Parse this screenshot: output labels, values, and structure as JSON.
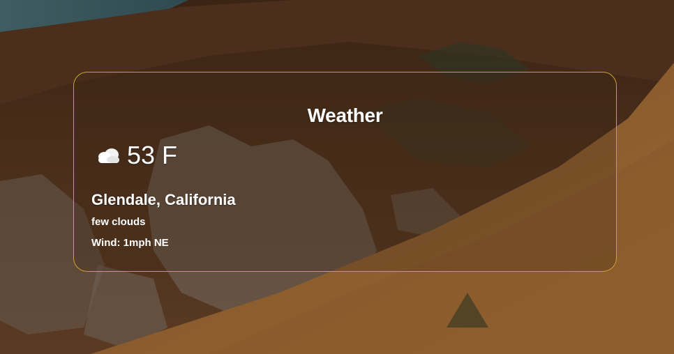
{
  "widget": {
    "title": "Weather",
    "icon": "cloud-icon",
    "temperature": "53 F",
    "location": "Glendale, California",
    "description": "few clouds",
    "wind": "Wind: 1mph NE"
  },
  "colors": {
    "card_border": "#c9a434",
    "text": "#ffffff",
    "background_base": "#4a2f1a"
  }
}
